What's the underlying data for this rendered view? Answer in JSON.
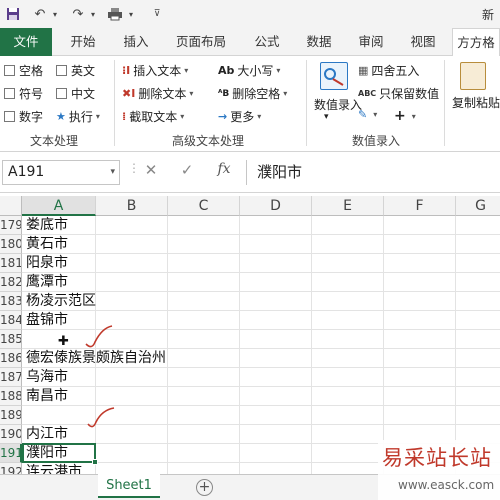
{
  "window": {
    "title": "新"
  },
  "tabs": [
    "文件",
    "开始",
    "插入",
    "页面布局",
    "公式",
    "数据",
    "审阅",
    "视图",
    "方方格"
  ],
  "ribbon": {
    "group1": {
      "label": "文本处理",
      "items": [
        "空格",
        "英文",
        "符号",
        "中文",
        "数字",
        "执行"
      ]
    },
    "group2": {
      "label": "高级文本处理",
      "items": [
        "插入文本",
        "删除文本",
        "截取文本",
        "大小写",
        "删除空格",
        "更多"
      ]
    },
    "group3": {
      "label": "数值录入",
      "big_button": "数值录入",
      "items": [
        "四舍五入",
        "只保留数值"
      ]
    },
    "group4": {
      "big_button": "复制粘贴"
    }
  },
  "formula_bar": {
    "name_box": "A191",
    "fx": "fx",
    "content": "濮阳市"
  },
  "columns": [
    "A",
    "B",
    "C",
    "D",
    "E",
    "F",
    "G"
  ],
  "rows": [
    {
      "num": "179",
      "a": "娄底市"
    },
    {
      "num": "180",
      "a": "黄石市"
    },
    {
      "num": "181",
      "a": "阳泉市"
    },
    {
      "num": "182",
      "a": "鹰潭市"
    },
    {
      "num": "183",
      "a": "杨凌示范区"
    },
    {
      "num": "184",
      "a": "盘锦市"
    },
    {
      "num": "185",
      "a": ""
    },
    {
      "num": "186",
      "a": "德宏傣族景颇族自治州"
    },
    {
      "num": "187",
      "a": "乌海市"
    },
    {
      "num": "188",
      "a": "南昌市"
    },
    {
      "num": "189",
      "a": ""
    },
    {
      "num": "190",
      "a": "内江市"
    },
    {
      "num": "191",
      "a": "濮阳市"
    },
    {
      "num": "192",
      "a": "连云港市"
    }
  ],
  "selected_row": "191",
  "sheet": {
    "tab": "Sheet1",
    "add": "+"
  },
  "watermark": {
    "main": "易采站长站",
    "sub": "www.easck.com"
  },
  "colors": {
    "accent": "#217346",
    "annotation": "#c0392b"
  }
}
